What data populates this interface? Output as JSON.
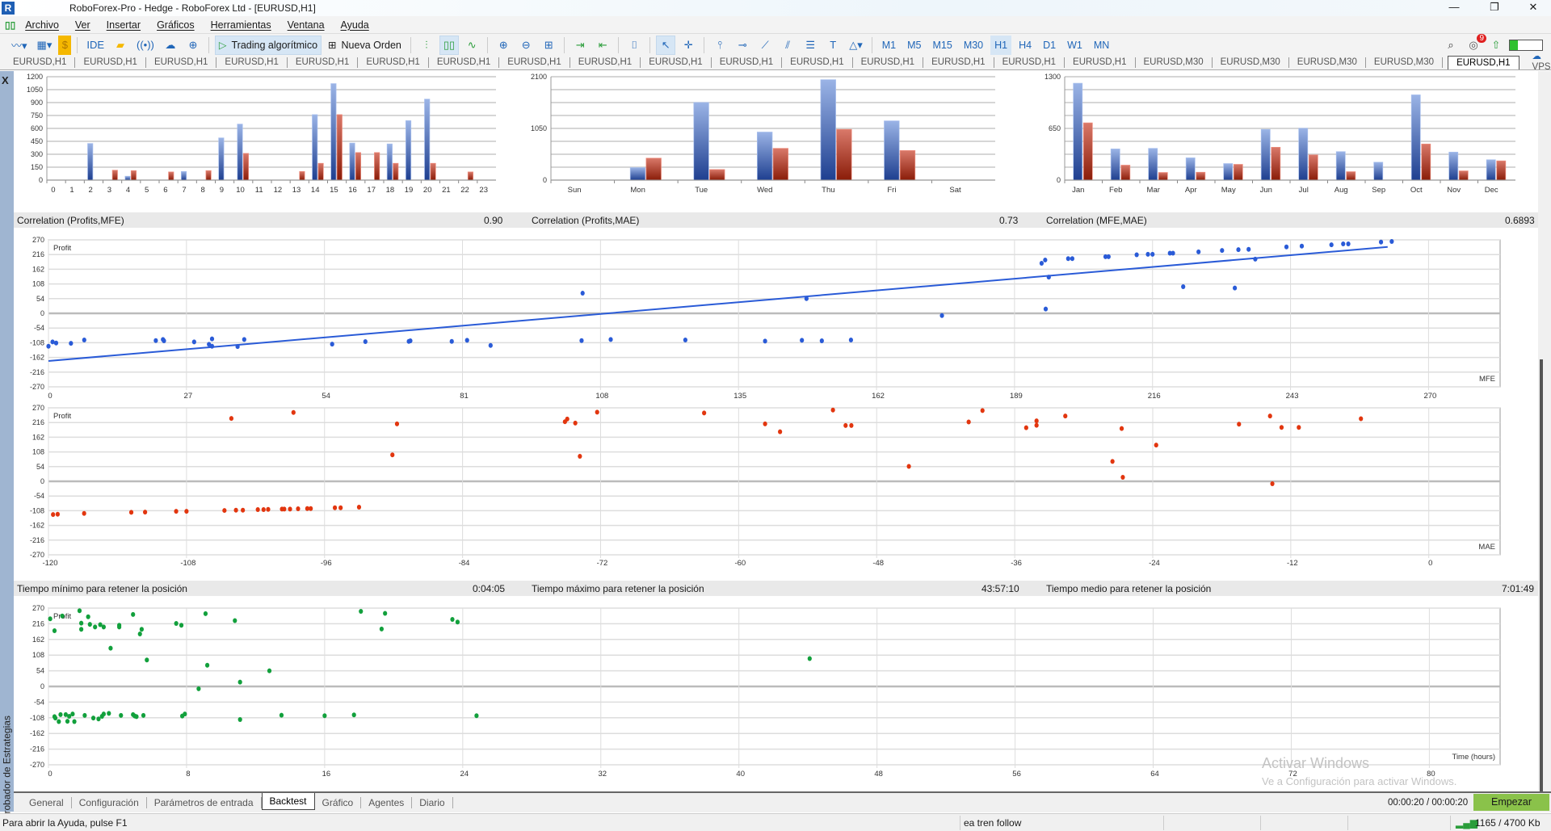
{
  "window": {
    "title": "RoboForex-Pro - Hedge - RoboForex Ltd - [EURUSD,H1]",
    "logo": "R",
    "controls": [
      "—",
      "❐",
      "✕"
    ]
  },
  "menu": [
    "Archivo",
    "Ver",
    "Insertar",
    "Gráficos",
    "Herramientas",
    "Ventana",
    "Ayuda"
  ],
  "toolbar": {
    "ide_label": "IDE",
    "algo_label": "Trading algorítmico",
    "new_order_label": "Nueva Orden",
    "timeframes": [
      "M1",
      "M5",
      "M15",
      "M30",
      "H1",
      "H4",
      "D1",
      "W1",
      "MN"
    ],
    "active_timeframe": "H1",
    "notification_count": "9",
    "icons": [
      "line-chart-icon",
      "chart-template-icon",
      "dollar-icon",
      "ide-icon",
      "market-bag-icon",
      "signals-icon",
      "cloud-icon",
      "web-add-icon",
      "play-icon",
      "new-order-icon",
      "bar-chart-icon",
      "candles-icon",
      "line-icon",
      "zoom-in-icon",
      "zoom-out-icon",
      "grid-icon",
      "autoscroll-icon",
      "chart-shift-icon",
      "screenshot-icon",
      "cursor-icon",
      "crosshair-icon",
      "vertical-line-icon",
      "horizontal-line-icon",
      "trendline-icon",
      "channel-icon",
      "fibonacci-icon",
      "text-icon",
      "shapes-icon",
      "search-icon",
      "notifications-icon",
      "lvl-icon"
    ]
  },
  "chart_tabs": [
    "EURUSD,H1",
    "EURUSD,H1",
    "EURUSD,H1",
    "EURUSD,H1",
    "EURUSD,H1",
    "EURUSD,H1",
    "EURUSD,H1",
    "EURUSD,H1",
    "EURUSD,H1",
    "EURUSD,H1",
    "EURUSD,H1",
    "EURUSD,H1",
    "EURUSD,H1",
    "EURUSD,H1",
    "EURUSD,H1",
    "EURUSD,H1",
    "EURUSD,M30",
    "EURUSD,M30",
    "EURUSD,M30",
    "EURUSD,M30",
    "EURUSD,H1"
  ],
  "active_chart_tab": 20,
  "vps_label": "VPS",
  "panel": {
    "close": "X",
    "side_label": "Probador de Estrategias"
  },
  "correlations": [
    {
      "label": "Correlation (Profits,MFE)",
      "value": "0.90"
    },
    {
      "label": "Correlation (Profits,MAE)",
      "value": "0.73"
    },
    {
      "label": "Correlation (MFE,MAE)",
      "value": "0.6893"
    }
  ],
  "hold_times": [
    {
      "label": "Tiempo mínimo para retener la posición",
      "value": "0:04:05"
    },
    {
      "label": "Tiempo máximo para retener la posición",
      "value": "43:57:10"
    },
    {
      "label": "Tiempo medio para retener la posición",
      "value": "7:01:49"
    }
  ],
  "colors": {
    "profit_bar": "#3a62b8",
    "loss_bar": "#b43a22",
    "mfe_points": "#2a5bd7",
    "mae_points": "#e2360f",
    "time_points": "#12a03c",
    "accent": "#2066b8",
    "start_button": "#8ac24a"
  },
  "chart_data": [
    {
      "type": "bar",
      "categories": [
        "0",
        "1",
        "2",
        "3",
        "4",
        "5",
        "6",
        "7",
        "8",
        "9",
        "10",
        "11",
        "12",
        "13",
        "14",
        "15",
        "16",
        "17",
        "18",
        "19",
        "20",
        "21",
        "22",
        "23"
      ],
      "series": [
        {
          "values": [
            0,
            0,
            425,
            0,
            45,
            0,
            0,
            100,
            0,
            490,
            650,
            0,
            0,
            0,
            760,
            1120,
            430,
            0,
            420,
            690,
            940,
            0,
            0,
            0
          ]
        },
        {
          "values": [
            0,
            0,
            0,
            115,
            110,
            0,
            95,
            0,
            110,
            0,
            310,
            0,
            0,
            100,
            195,
            760,
            320,
            320,
            195,
            0,
            195,
            0,
            95,
            0
          ]
        }
      ],
      "ylim": [
        0,
        1200
      ],
      "yticks": [
        0,
        150,
        300,
        450,
        600,
        750,
        900,
        1050,
        1200
      ],
      "ygrid_step": 150,
      "grid": true
    },
    {
      "type": "bar",
      "categories": [
        "Sun",
        "Mon",
        "Tue",
        "Wed",
        "Thu",
        "Fri",
        "Sat"
      ],
      "series": [
        {
          "values": [
            0,
            254,
            1577,
            976,
            2040,
            1203,
            0
          ]
        },
        {
          "values": [
            0,
            446,
            215,
            645,
            1031,
            601,
            0
          ]
        }
      ],
      "ylim": [
        0,
        2100
      ],
      "yticks": [
        0,
        1050,
        2100
      ],
      "ygrid_step": 262.5,
      "grid": true
    },
    {
      "type": "bar",
      "categories": [
        "Jan",
        "Feb",
        "Mar",
        "Apr",
        "May",
        "Jun",
        "Jul",
        "Aug",
        "Sep",
        "Oct",
        "Nov",
        "Dec"
      ],
      "series": [
        {
          "values": [
            1218,
            392,
            399,
            280,
            208,
            638,
            652,
            358,
            225,
            1072,
            352,
            256
          ]
        },
        {
          "values": [
            720,
            188,
            96,
            99,
            198,
            413,
            317,
            106,
            0,
            454,
            116,
            242
          ]
        }
      ],
      "ylim": [
        0,
        1300
      ],
      "yticks": [
        0,
        650,
        1300
      ],
      "ygrid_step": 162.5,
      "grid": true
    },
    {
      "type": "scatter",
      "ylabel": "Profit",
      "xlabel": "MFE",
      "xlim": [
        0,
        284
      ],
      "ylim": [
        -270,
        270
      ],
      "xticks": [
        0,
        27,
        54,
        81,
        108,
        135,
        162,
        189,
        216,
        243,
        270
      ],
      "yticks": [
        270,
        216,
        162,
        108,
        54,
        0,
        -54,
        -108,
        -162,
        -216,
        -270
      ],
      "trendline": [
        [
          0,
          -175
        ],
        [
          262,
          244
        ]
      ],
      "points": [
        [
          0,
          -121
        ],
        [
          0.8,
          -105
        ],
        [
          1.5,
          -109
        ],
        [
          4.4,
          -110
        ],
        [
          7,
          -98
        ],
        [
          21,
          -100
        ],
        [
          22.4,
          -96
        ],
        [
          22.6,
          -101
        ],
        [
          28.5,
          -105
        ],
        [
          31.4,
          -114
        ],
        [
          32,
          -94
        ],
        [
          32,
          -121
        ],
        [
          37,
          -122
        ],
        [
          38.3,
          -96
        ],
        [
          55.5,
          -113
        ],
        [
          62,
          -104
        ],
        [
          70.5,
          -103
        ],
        [
          70.8,
          -101
        ],
        [
          78.9,
          -103
        ],
        [
          81.9,
          -99
        ],
        [
          86.5,
          -118
        ],
        [
          104.3,
          -100
        ],
        [
          104.5,
          74
        ],
        [
          110,
          -96
        ],
        [
          124.6,
          -98
        ],
        [
          140.2,
          -102
        ],
        [
          147.4,
          -99
        ],
        [
          151.3,
          -101
        ],
        [
          157,
          -98
        ],
        [
          148.3,
          54
        ],
        [
          174.8,
          -8
        ],
        [
          194.3,
          184
        ],
        [
          195,
          196
        ],
        [
          195.1,
          16
        ],
        [
          195.7,
          133
        ],
        [
          199.5,
          201
        ],
        [
          200.3,
          201
        ],
        [
          206.8,
          208
        ],
        [
          207.4,
          208
        ],
        [
          212.9,
          215
        ],
        [
          215.1,
          217
        ],
        [
          216,
          217
        ],
        [
          219.4,
          221
        ],
        [
          220,
          221
        ],
        [
          222,
          98
        ],
        [
          225,
          226
        ],
        [
          229.6,
          231
        ],
        [
          232.1,
          93
        ],
        [
          232.8,
          234
        ],
        [
          234.8,
          235
        ],
        [
          236.1,
          199
        ],
        [
          242.2,
          244
        ],
        [
          245.2,
          247
        ],
        [
          251,
          252
        ],
        [
          253.3,
          255
        ],
        [
          254.3,
          255
        ],
        [
          260.7,
          262
        ],
        [
          262.8,
          264
        ]
      ]
    },
    {
      "type": "scatter",
      "ylabel": "Profit",
      "xlabel": "MAE",
      "xlim": [
        -120,
        6.2
      ],
      "ylim": [
        -270,
        270
      ],
      "xticks": [
        -120,
        -108,
        -96,
        -84,
        -72,
        -60,
        -48,
        -36,
        -24,
        -12,
        0
      ],
      "yticks": [
        270,
        216,
        162,
        108,
        54,
        0,
        -54,
        -108,
        -162,
        -216,
        -270
      ],
      "points": [
        [
          -119.6,
          -122
        ],
        [
          -119.2,
          -121
        ],
        [
          -116.9,
          -118
        ],
        [
          -112.8,
          -114
        ],
        [
          -111.6,
          -113
        ],
        [
          -108.9,
          -110
        ],
        [
          -108,
          -110
        ],
        [
          -104.7,
          -107
        ],
        [
          -103.7,
          -106
        ],
        [
          -103.1,
          -106
        ],
        [
          -101.8,
          -104
        ],
        [
          -101.3,
          -104
        ],
        [
          -100.9,
          -103
        ],
        [
          -99.7,
          -102
        ],
        [
          -99.5,
          -102
        ],
        [
          -99,
          -102
        ],
        [
          -98.3,
          -101
        ],
        [
          -97.5,
          -100
        ],
        [
          -97.2,
          -100
        ],
        [
          -95.1,
          -97
        ],
        [
          -94.6,
          -97
        ],
        [
          -93,
          -95
        ],
        [
          -104.1,
          231
        ],
        [
          -98.7,
          253
        ],
        [
          -90.1,
          97
        ],
        [
          -89.7,
          211
        ],
        [
          -75.1,
          219
        ],
        [
          -74.9,
          229
        ],
        [
          -74.2,
          214
        ],
        [
          -73.8,
          92
        ],
        [
          -72.3,
          254
        ],
        [
          -63,
          251
        ],
        [
          -57.7,
          211
        ],
        [
          -56.4,
          182
        ],
        [
          -51.8,
          262
        ],
        [
          -50.7,
          205
        ],
        [
          -50.2,
          205
        ],
        [
          -45.2,
          55
        ],
        [
          -40,
          218
        ],
        [
          -38.8,
          260
        ],
        [
          -35,
          197
        ],
        [
          -34.1,
          222
        ],
        [
          -34.1,
          206
        ],
        [
          -31.6,
          240
        ],
        [
          -27.5,
          73
        ],
        [
          -26.7,
          194
        ],
        [
          -26.6,
          15
        ],
        [
          -23.7,
          133
        ],
        [
          -16.5,
          210
        ],
        [
          -13.8,
          240
        ],
        [
          -13.6,
          -9
        ],
        [
          -12.8,
          198
        ],
        [
          -11.3,
          198
        ],
        [
          -5.9,
          230
        ]
      ]
    },
    {
      "type": "scatter",
      "ylabel": "Profit",
      "xlabel": "Time (hours)",
      "xlim": [
        0,
        84.1
      ],
      "ylim": [
        -270,
        270
      ],
      "xticks": [
        0,
        8,
        16,
        24,
        32,
        40,
        48,
        56,
        64,
        72,
        80
      ],
      "yticks": [
        270,
        216,
        162,
        108,
        54,
        0,
        -54,
        -108,
        -162,
        -216,
        -270
      ],
      "points": [
        [
          0.1,
          233
        ],
        [
          0.35,
          192
        ],
        [
          0.8,
          243
        ],
        [
          1.8,
          261
        ],
        [
          1.9,
          218
        ],
        [
          1.9,
          197
        ],
        [
          2.3,
          240
        ],
        [
          2.4,
          214
        ],
        [
          2.7,
          205
        ],
        [
          3,
          213
        ],
        [
          3.2,
          205
        ],
        [
          3.6,
          132
        ],
        [
          4.1,
          211
        ],
        [
          4.1,
          205
        ],
        [
          4.9,
          248
        ],
        [
          5.3,
          181
        ],
        [
          5.4,
          197
        ],
        [
          5.7,
          91
        ],
        [
          7.4,
          217
        ],
        [
          7.7,
          211
        ],
        [
          8.7,
          -8
        ],
        [
          9.1,
          251
        ],
        [
          9.2,
          73
        ],
        [
          10.8,
          227
        ],
        [
          11.1,
          15
        ],
        [
          12.8,
          54
        ],
        [
          18.1,
          259
        ],
        [
          19.3,
          198
        ],
        [
          19.5,
          252
        ],
        [
          23.4,
          231
        ],
        [
          23.7,
          222
        ],
        [
          0.35,
          -104
        ],
        [
          0.4,
          -109
        ],
        [
          0.6,
          -121
        ],
        [
          0.7,
          -97
        ],
        [
          1,
          -97
        ],
        [
          1.1,
          -120
        ],
        [
          1.2,
          -103
        ],
        [
          1.4,
          -95
        ],
        [
          1.5,
          -121
        ],
        [
          2.1,
          -100
        ],
        [
          2.6,
          -109
        ],
        [
          2.9,
          -112
        ],
        [
          3.1,
          -103
        ],
        [
          3.2,
          -95
        ],
        [
          3.5,
          -93
        ],
        [
          4.2,
          -100
        ],
        [
          4.9,
          -97
        ],
        [
          5,
          -102
        ],
        [
          5.1,
          -104
        ],
        [
          5.5,
          -100
        ],
        [
          7.75,
          -102
        ],
        [
          7.9,
          -95
        ],
        [
          11.1,
          -114
        ],
        [
          13.5,
          -99
        ],
        [
          16,
          -101
        ],
        [
          17.7,
          -98
        ],
        [
          24.8,
          -101
        ],
        [
          44.1,
          96
        ]
      ]
    }
  ],
  "bottom_tabs": [
    "General",
    "Configuración",
    "Parámetros de entrada",
    "Backtest",
    "Gráfico",
    "Agentes",
    "Diario"
  ],
  "active_bottom_tab": 3,
  "timer": "00:00:20 / 00:00:20",
  "start_label": "Empezar",
  "status": {
    "help": "Para abrir la Ayuda, pulse F1",
    "profile": "ea tren follow",
    "traffic": "1165 / 4700 Kb"
  },
  "watermark": {
    "line1": "Activar Windows",
    "line2": "Ve a Configuración para activar Windows."
  }
}
